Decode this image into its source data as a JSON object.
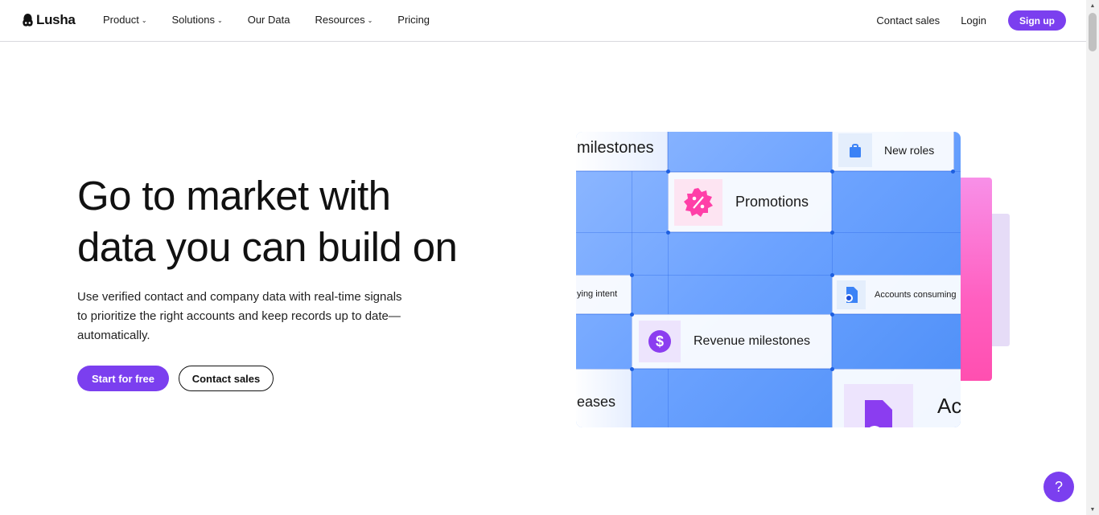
{
  "brand": {
    "name": "Lusha"
  },
  "nav": {
    "items": [
      {
        "label": "Product",
        "dropdown": true
      },
      {
        "label": "Solutions",
        "dropdown": true
      },
      {
        "label": "Our Data",
        "dropdown": false
      },
      {
        "label": "Resources",
        "dropdown": true
      },
      {
        "label": "Pricing",
        "dropdown": false
      }
    ],
    "contact_sales": "Contact sales",
    "login": "Login",
    "signup": "Sign up"
  },
  "hero": {
    "title_line1": "Go to market with",
    "title_line2": "data you can build on",
    "sub_line1": "Use verified contact and company data with real-time signals",
    "sub_line2": "to prioritize the right accounts and keep records up to date—",
    "sub_line3": "automatically.",
    "cta_primary": "Start for free",
    "cta_secondary": "Contact sales"
  },
  "visual_cards": {
    "milestones": "milestones",
    "new_roles": "New roles",
    "promotions": "Promotions",
    "buying_intent": "ying intent",
    "accounts_consuming": "Accounts consuming",
    "revenue_milestones": "Revenue milestones",
    "releases": "eases",
    "accounts_partial": "Ac"
  },
  "colors": {
    "accent": "#7b3fef",
    "panel_blue": "#6da3ff",
    "pink": "#ff5fc0",
    "promo_icon": "#ff3fa8"
  },
  "help": {
    "label": "?"
  }
}
